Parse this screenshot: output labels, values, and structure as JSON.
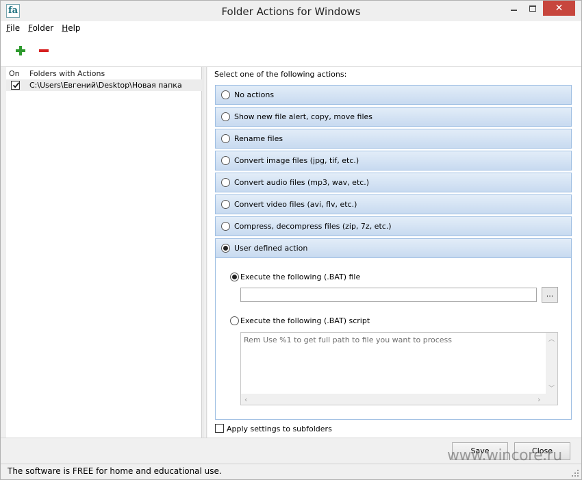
{
  "window": {
    "title": "Folder Actions for Windows",
    "logo_text": "fa",
    "close_glyph": "✕"
  },
  "menu": {
    "items": [
      {
        "underline": "F",
        "rest": "ile"
      },
      {
        "underline": "F",
        "rest": "older"
      },
      {
        "underline": "H",
        "rest": "elp"
      }
    ]
  },
  "toolbar": {
    "add_icon": "plus-icon",
    "remove_icon": "minus-icon",
    "add_color": "#2e9a2e",
    "remove_color": "#d62020"
  },
  "folders": {
    "col_on": "On",
    "col_folders": "Folders with Actions",
    "rows": [
      {
        "checked": true,
        "path": "C:\\Users\\Евгений\\Desktop\\Новая папка"
      }
    ]
  },
  "actions": {
    "header": "Select one of the following actions:",
    "options": [
      {
        "label": "No actions",
        "selected": false
      },
      {
        "label": "Show new file alert, copy, move files",
        "selected": false
      },
      {
        "label": "Rename files",
        "selected": false
      },
      {
        "label": "Convert image files (jpg, tif, etc.)",
        "selected": false
      },
      {
        "label": "Convert audio files (mp3, wav, etc.)",
        "selected": false
      },
      {
        "label": "Convert video files (avi, flv, etc.)",
        "selected": false
      },
      {
        "label": "Compress, decompress files (zip, 7z, etc.)",
        "selected": false
      },
      {
        "label": "User defined action",
        "selected": true
      }
    ],
    "user_defined": {
      "bat_file_label": "Execute the following (.BAT) file",
      "bat_file_value": "",
      "browse_label": "...",
      "bat_script_label": "Execute the following (.BAT) script",
      "bat_script_text": "Rem Use %1 to get full path to file you want to process"
    },
    "subfolders_label": "Apply settings to subfolders"
  },
  "buttons": {
    "save": "Save",
    "close": "Close"
  },
  "watermark": "www.wincore.ru",
  "status": "The software is FREE for home and educational use."
}
